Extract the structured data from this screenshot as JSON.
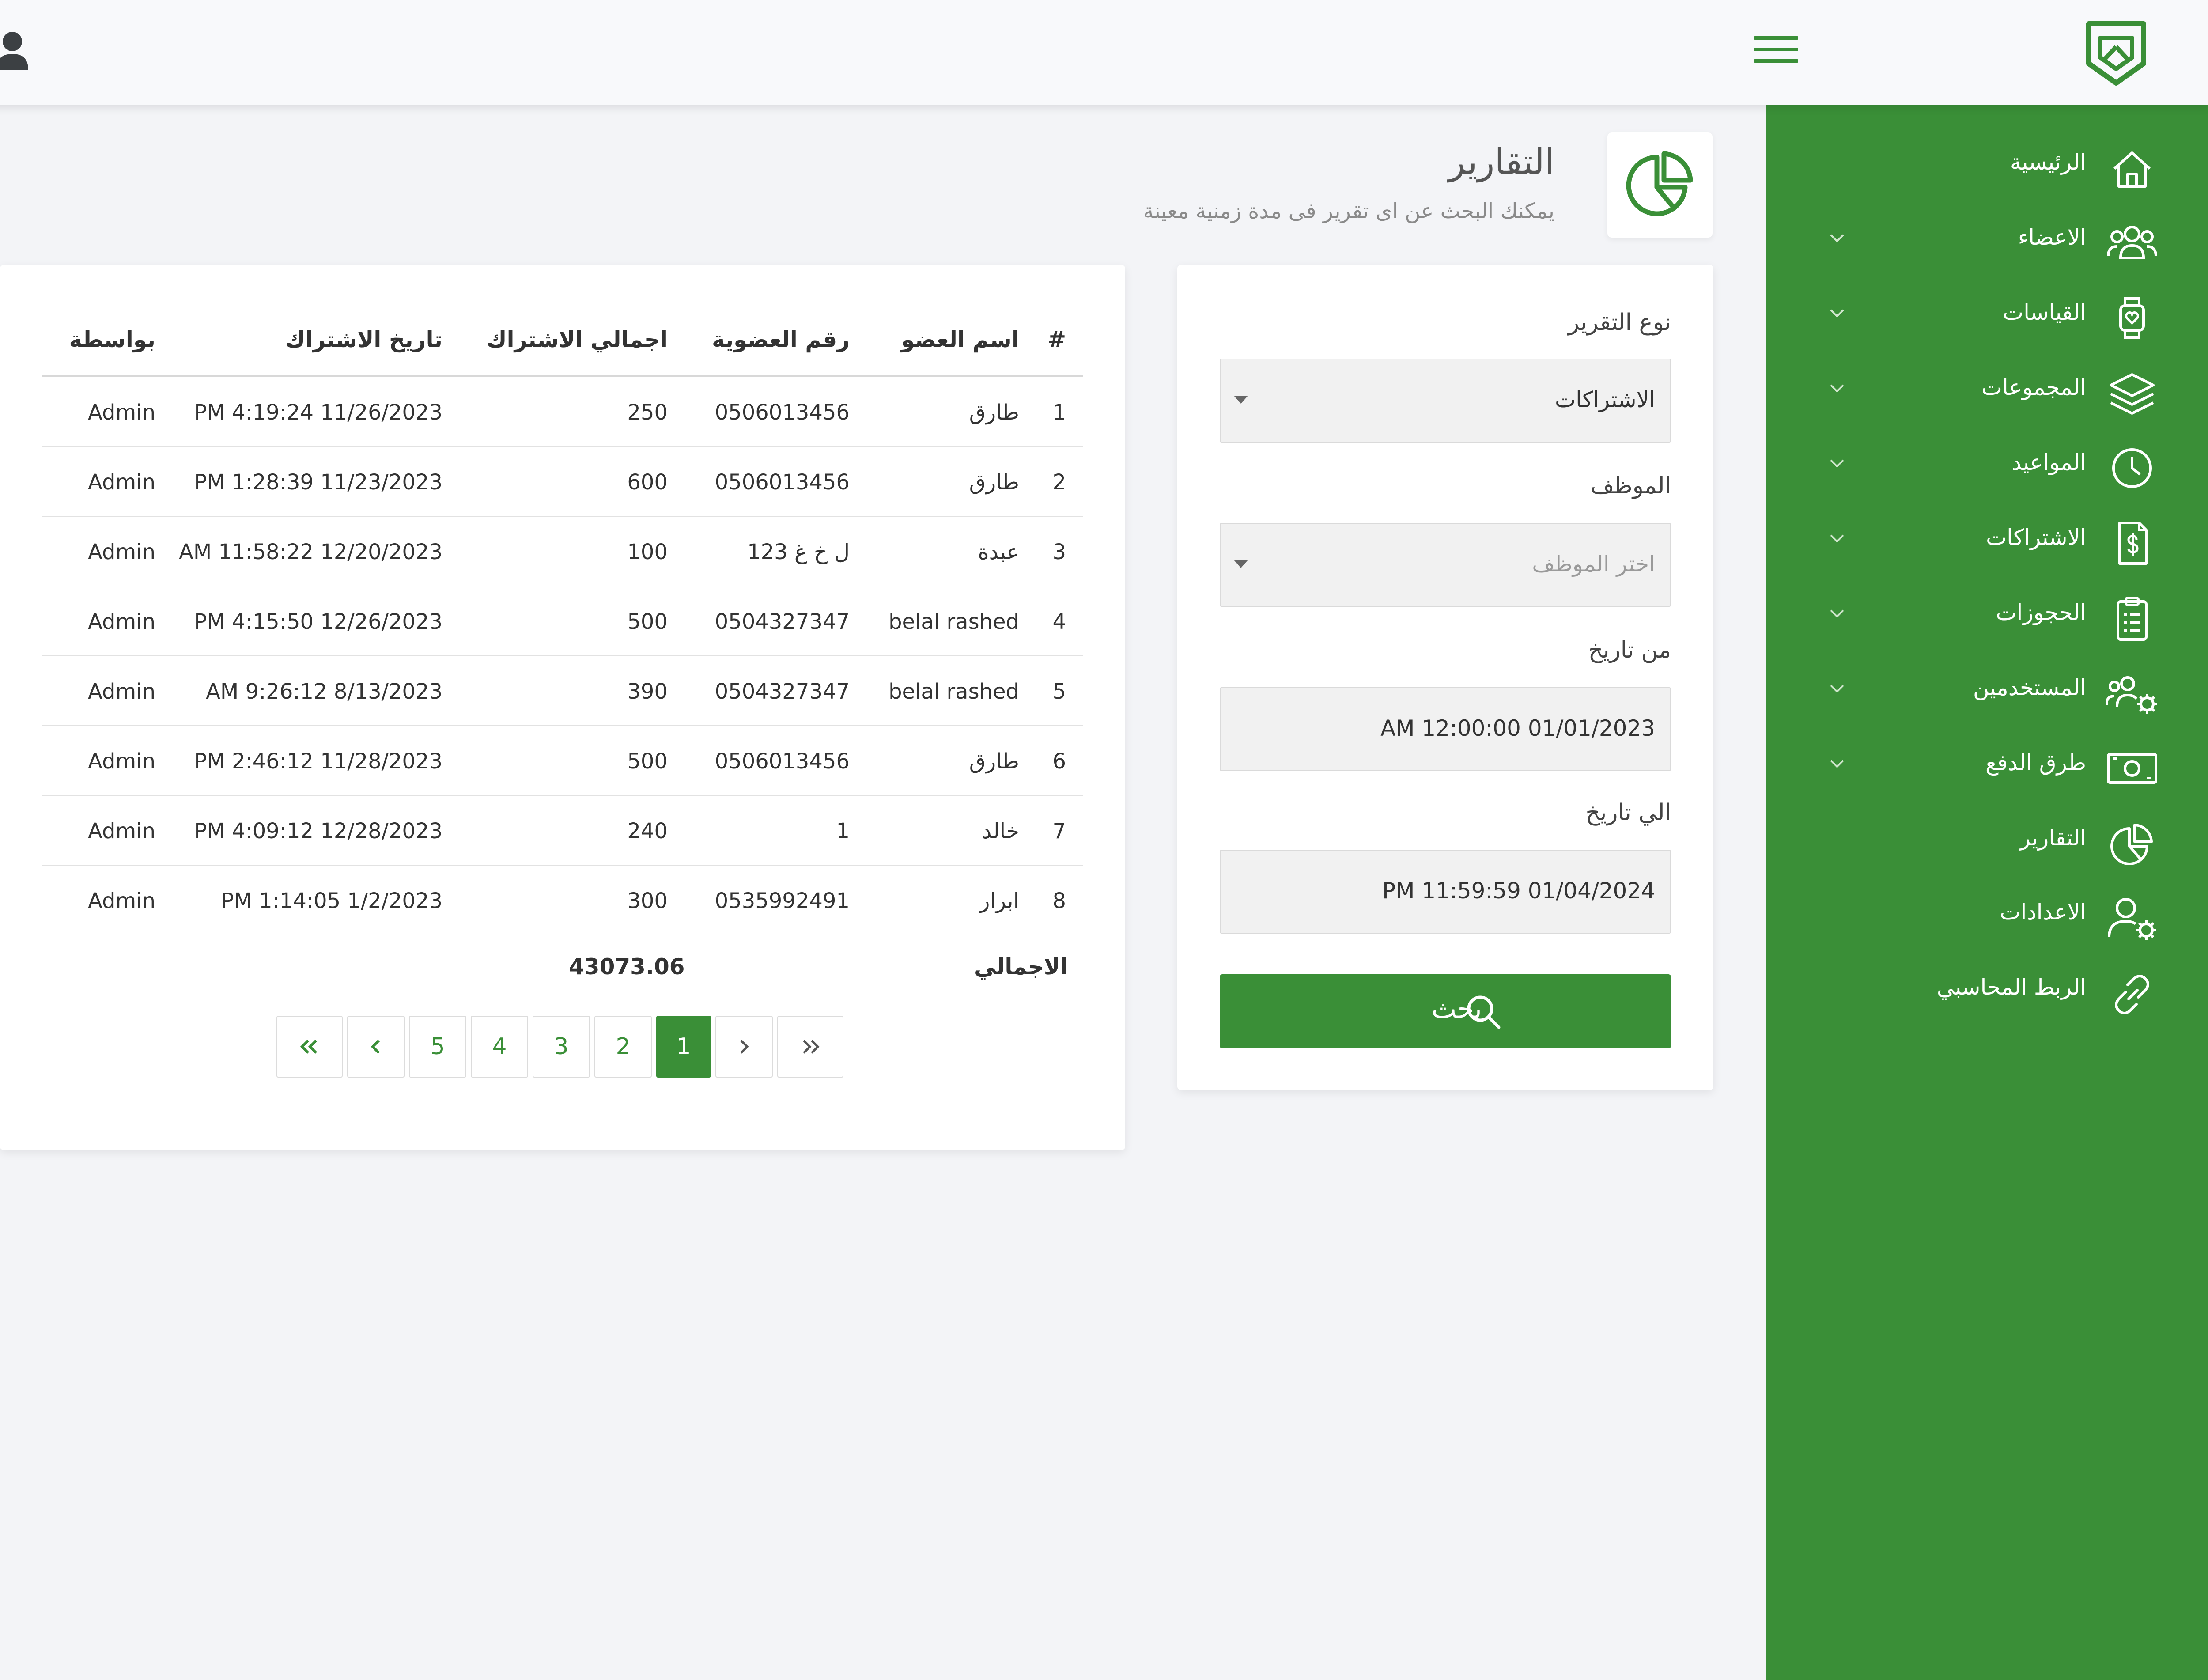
{
  "colors": {
    "accent": "#3a8f37",
    "background": "#f3f4f7",
    "card": "#ffffff"
  },
  "topbar": {
    "menu_icon": "hamburger-icon",
    "user_icon": "user-icon",
    "logo_icon": "shield-logo-icon"
  },
  "sidebar": {
    "items": [
      {
        "label": "الرئيسية",
        "icon": "home-icon",
        "has_submenu": false
      },
      {
        "label": "الاعضاء",
        "icon": "users-icon",
        "has_submenu": true
      },
      {
        "label": "القياسات",
        "icon": "watch-icon",
        "has_submenu": true
      },
      {
        "label": "المجموعات",
        "icon": "layers-icon",
        "has_submenu": true
      },
      {
        "label": "المواعيد",
        "icon": "clock-icon",
        "has_submenu": true
      },
      {
        "label": "الاشتراكات",
        "icon": "invoice-icon",
        "has_submenu": true
      },
      {
        "label": "الحجوزات",
        "icon": "clipboard-icon",
        "has_submenu": true
      },
      {
        "label": "المستخدمين",
        "icon": "users-gear-icon",
        "has_submenu": true
      },
      {
        "label": "طرق الدفع",
        "icon": "cash-icon",
        "has_submenu": true
      },
      {
        "label": "التقارير",
        "icon": "pie-chart-icon",
        "has_submenu": false
      },
      {
        "label": "الاعدادات",
        "icon": "user-gear-icon",
        "has_submenu": false
      },
      {
        "label": "الربط المحاسبي",
        "icon": "link-icon",
        "has_submenu": false
      }
    ]
  },
  "page": {
    "title": "التقارير",
    "subtitle": "يمكنك البحث عن اى تقرير فى مدة زمنية معينة",
    "icon": "pie-chart-icon"
  },
  "search": {
    "report_type_label": "نوع التقرير",
    "report_type_value": "الاشتراكات",
    "employee_label": "الموظف",
    "employee_placeholder": "اختر الموظف",
    "from_label": "من تاريخ",
    "from_value": "AM 12:00:00 01/01/2023",
    "to_label": "الي تاريخ",
    "to_value": "PM 11:59:59 01/04/2024",
    "button_label": "بحث"
  },
  "table": {
    "headers": {
      "index": "#",
      "name": "اسم العضو",
      "membership": "رقم العضوية",
      "total": "اجمالي الاشتراك",
      "date": "تاريخ الاشتراك",
      "by": "بواسطة"
    },
    "rows": [
      {
        "index": "1",
        "name": "طارق",
        "membership": "0506013456",
        "total": "250",
        "date": "PM 4:19:24 11/26/2023",
        "by": "Admin"
      },
      {
        "index": "2",
        "name": "طارق",
        "membership": "0506013456",
        "total": "600",
        "date": "PM 1:28:39 11/23/2023",
        "by": "Admin"
      },
      {
        "index": "3",
        "name": "عبدة",
        "membership": "ل خ غ 123",
        "total": "100",
        "date": "AM 11:58:22 12/20/2023",
        "by": "Admin"
      },
      {
        "index": "4",
        "name": "belal rashed",
        "membership": "0504327347",
        "total": "500",
        "date": "PM 4:15:50 12/26/2023",
        "by": "Admin"
      },
      {
        "index": "5",
        "name": "belal rashed",
        "membership": "0504327347",
        "total": "390",
        "date": "AM 9:26:12 8/13/2023",
        "by": "Admin"
      },
      {
        "index": "6",
        "name": "طارق",
        "membership": "0506013456",
        "total": "500",
        "date": "PM 2:46:12 11/28/2023",
        "by": "Admin"
      },
      {
        "index": "7",
        "name": "خالد",
        "membership": "1",
        "total": "240",
        "date": "PM 4:09:12 12/28/2023",
        "by": "Admin"
      },
      {
        "index": "8",
        "name": "ابرار",
        "membership": "0535992491",
        "total": "300",
        "date": "PM 1:14:05 1/2/2023",
        "by": "Admin"
      }
    ],
    "total_label": "الاجمالي",
    "total_value": "43073.06"
  },
  "pagination": {
    "pages": [
      "1",
      "2",
      "3",
      "4",
      "5"
    ],
    "active_page": "1"
  }
}
